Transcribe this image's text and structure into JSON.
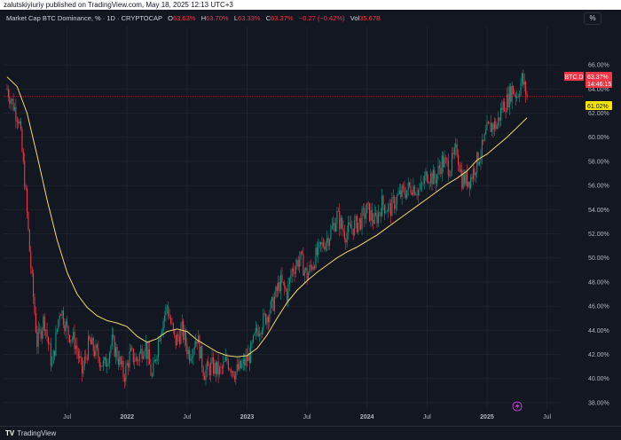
{
  "header": {
    "published_text": "zalutskiyiuriy published on TradingView.com, May 18, 2025 12:13 UTC+3"
  },
  "legend": {
    "symbol": "Market Cap BTC Dominance, % · 1D · CRYPTOCAP",
    "open_label": "O",
    "open": "63.63%",
    "high_label": "H",
    "high": "63.70%",
    "low_label": "L",
    "low": "63.33%",
    "close_label": "C",
    "close": "63.37%",
    "change": "−0.27 (−0.42%)",
    "vol_label": "Vol",
    "vol": "35.67B"
  },
  "toolbar": {
    "percent_button": "%"
  },
  "price_badge": {
    "symbol": "BTC.D",
    "price": "63.37%",
    "countdown": "14:46:15"
  },
  "ma_badge": {
    "value": "61.02%"
  },
  "footer": {
    "logo": "TV",
    "brand": "TradingView"
  },
  "colors": {
    "background": "#131722",
    "up": "#089981",
    "down": "#f23645",
    "ma": "#f5d76e",
    "grid": "#1e222d",
    "axis_text": "#b2b5be"
  },
  "chart_data": {
    "type": "candlestick",
    "ylim": [
      37,
      67
    ],
    "y_ticks": [
      "66.00%",
      "64.00%",
      "62.00%",
      "60.00%",
      "58.00%",
      "56.00%",
      "54.00%",
      "52.00%",
      "50.00%",
      "48.00%",
      "46.00%",
      "44.00%",
      "42.00%",
      "40.00%",
      "38.00%"
    ],
    "y_tick_values": [
      66,
      64,
      62,
      60,
      58,
      56,
      54,
      52,
      50,
      48,
      46,
      44,
      42,
      40,
      38
    ],
    "x_ticks": [
      "Jul",
      "2022",
      "Jul",
      "2023",
      "Jul",
      "2024",
      "Jul",
      "2025",
      "Jul"
    ],
    "x_tick_months": [
      6,
      12,
      18,
      24,
      30,
      36,
      42,
      48,
      54
    ],
    "x_start": "2021-01",
    "x_end": "2025-09",
    "current_price": 63.37,
    "price_line_color": "#f23645",
    "price_series": {
      "name": "BTC.D",
      "months": [
        0,
        0.7,
        1.2,
        1.8,
        2.3,
        3,
        3.7,
        4.5,
        5.3,
        6,
        6.8,
        7.5,
        8.2,
        9,
        9.7,
        10.5,
        11,
        11.7,
        12.3,
        13,
        13.8,
        14.5,
        15.3,
        16,
        16.8,
        17.5,
        18.2,
        19,
        19.7,
        20.5,
        21.3,
        22,
        22.8,
        23.5,
        24.3,
        25,
        25.8,
        26.5,
        27.3,
        28,
        28.5,
        29.3,
        30,
        30.8,
        31.5,
        32.3,
        33,
        33.8,
        34.5,
        35.3,
        36,
        36.8,
        37.5,
        38.3,
        39,
        39.8,
        40.5,
        41.3,
        42,
        42.8,
        43.5,
        44.3,
        45,
        45.5,
        46.3,
        47,
        47.5,
        48,
        48.5,
        49,
        49.5,
        50,
        50.5,
        51,
        51.5,
        52
      ],
      "values": [
        64,
        62.5,
        61.5,
        56,
        50,
        43,
        45,
        41,
        46,
        44,
        43,
        40.5,
        43,
        42,
        41,
        43,
        42,
        40.2,
        42,
        41.5,
        43,
        40,
        44,
        46,
        43,
        44,
        42,
        43.5,
        40.5,
        41,
        40.5,
        41.5,
        40.5,
        41,
        42,
        44,
        45,
        46,
        48,
        47,
        49,
        50,
        48.5,
        50,
        51,
        52,
        53.5,
        52,
        52.5,
        53,
        54,
        53,
        54.5,
        54,
        55,
        55.5,
        56,
        55.5,
        57,
        56.5,
        58,
        57.5,
        59,
        56.5,
        56.5,
        58,
        59,
        60.5,
        61,
        61,
        62.5,
        63,
        64,
        63.5,
        64.8,
        63.4
      ]
    },
    "ma_series": {
      "months": [
        0,
        1,
        2,
        3,
        4,
        5,
        6,
        7,
        8,
        9,
        10,
        11,
        12,
        13,
        14,
        15,
        16,
        17,
        18,
        19,
        20,
        21,
        22,
        23,
        24,
        25,
        26,
        27,
        28,
        29,
        30,
        31,
        32,
        33,
        34,
        35,
        36,
        37,
        38,
        39,
        40,
        41,
        42,
        43,
        44,
        45,
        46,
        47,
        48,
        49,
        50,
        51,
        52
      ],
      "values": [
        65,
        64.2,
        62,
        58.5,
        54.8,
        51.5,
        48.8,
        47,
        45.9,
        45.2,
        44.8,
        44.6,
        44.3,
        43.5,
        43,
        43.3,
        43.9,
        44.1,
        43.9,
        43.2,
        42.7,
        42.2,
        41.9,
        41.8,
        41.9,
        42.5,
        43.6,
        45,
        46.3,
        47.3,
        48.1,
        48.8,
        49.4,
        50,
        50.5,
        50.9,
        51.4,
        51.9,
        52.5,
        53.1,
        53.7,
        54.3,
        54.9,
        55.5,
        56.1,
        56.6,
        57.2,
        58.1,
        58.6,
        59.3,
        60,
        60.8,
        61.6
      ]
    }
  }
}
